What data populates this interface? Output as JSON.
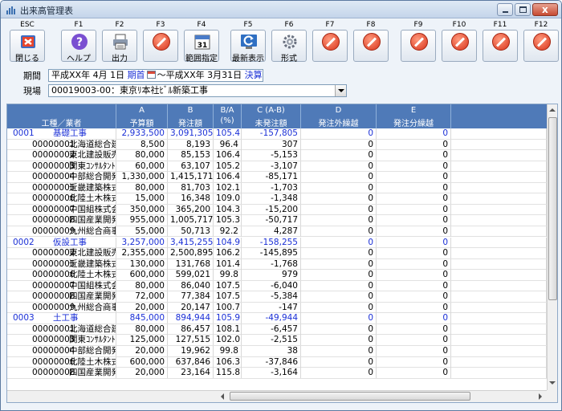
{
  "window": {
    "title": "出来高管理表",
    "close_glyph": "x",
    "colors": {
      "titlebar": "#c4d5ea",
      "header": "#4f7ab8",
      "group_text": "#1a2fd6",
      "close": "#c74b32"
    }
  },
  "toolbar": {
    "buttons": [
      {
        "key": "ESC",
        "label": "閉じる",
        "icon": "exit-icon"
      },
      {
        "key": "F1",
        "label": "ヘルプ",
        "icon": "help-icon"
      },
      {
        "key": "F2",
        "label": "出力",
        "icon": "printer-icon"
      },
      {
        "key": "F3",
        "label": "",
        "icon": "disabled-icon"
      },
      {
        "key": "F4",
        "label": "範囲指定",
        "icon": "calendar-icon"
      },
      {
        "key": "F5",
        "label": "最新表示",
        "icon": "refresh-icon"
      },
      {
        "key": "F6",
        "label": "形式",
        "icon": "gear-icon"
      },
      {
        "key": "F7",
        "label": "",
        "icon": "disabled-icon"
      },
      {
        "key": "F8",
        "label": "",
        "icon": "disabled-icon"
      },
      {
        "key": "F9",
        "label": "",
        "icon": "disabled-icon"
      },
      {
        "key": "F10",
        "label": "",
        "icon": "disabled-icon"
      },
      {
        "key": "F11",
        "label": "",
        "icon": "disabled-icon"
      },
      {
        "key": "F12",
        "label": "",
        "icon": "disabled-icon"
      }
    ]
  },
  "filters": {
    "period_label": "期間",
    "period_from": "平成XX年 4月 1日",
    "period_from_tag": "期首",
    "period_sep": "～",
    "period_to": "平成XX年 3月31日",
    "period_to_tag": "決算",
    "site_label": "現場",
    "site_value": "00019003-00：東京ﾘ本社ﾋﾞﾙ新築工事"
  },
  "grid": {
    "columns": [
      {
        "l1": "",
        "l2": "工種／業者"
      },
      {
        "l1": "A",
        "l2": "予算額"
      },
      {
        "l1": "B",
        "l2": "発注額"
      },
      {
        "l1": "B/A",
        "l2": "(%)"
      },
      {
        "l1": "C (A-B)",
        "l2": "未発注額"
      },
      {
        "l1": "D",
        "l2": "発注外繰越"
      },
      {
        "l1": "E",
        "l2": "発注分繰越"
      }
    ],
    "rows": [
      {
        "group": true,
        "code": "0001",
        "name": "基礎工事",
        "a": "2,933,500",
        "b": "3,091,305",
        "pct": "105.4",
        "c": "-157,805",
        "d": "0",
        "e": "0"
      },
      {
        "group": false,
        "code": "00000001",
        "name": "北海道総合建設株",
        "a": "8,500",
        "b": "8,193",
        "pct": "96.4",
        "c": "307",
        "d": "0",
        "e": "0"
      },
      {
        "group": false,
        "code": "00000002",
        "name": "東北建設販売株式",
        "a": "80,000",
        "b": "85,153",
        "pct": "106.4",
        "c": "-5,153",
        "d": "0",
        "e": "0"
      },
      {
        "group": false,
        "code": "00000003",
        "name": "関東ｺﾝｻﾙﾀﾝﾄ株式",
        "a": "60,000",
        "b": "63,107",
        "pct": "105.2",
        "c": "-3,107",
        "d": "0",
        "e": "0"
      },
      {
        "group": false,
        "code": "00000004",
        "name": "中部総合開発株式",
        "a": "1,330,000",
        "b": "1,415,171",
        "pct": "106.4",
        "c": "-85,171",
        "d": "0",
        "e": "0"
      },
      {
        "group": false,
        "code": "00000005",
        "name": "近畿建築株式会社",
        "a": "80,000",
        "b": "81,703",
        "pct": "102.1",
        "c": "-1,703",
        "d": "0",
        "e": "0"
      },
      {
        "group": false,
        "code": "00000006",
        "name": "北陸土木株式会社",
        "a": "15,000",
        "b": "16,348",
        "pct": "109.0",
        "c": "-1,348",
        "d": "0",
        "e": "0"
      },
      {
        "group": false,
        "code": "00000007",
        "name": "中国組株式会社",
        "a": "350,000",
        "b": "365,200",
        "pct": "104.3",
        "c": "-15,200",
        "d": "0",
        "e": "0"
      },
      {
        "group": false,
        "code": "00000008",
        "name": "四国産業開発株式",
        "a": "955,000",
        "b": "1,005,717",
        "pct": "105.3",
        "c": "-50,717",
        "d": "0",
        "e": "0"
      },
      {
        "group": false,
        "code": "00000009",
        "name": "九州総合商事株式",
        "a": "55,000",
        "b": "50,713",
        "pct": "92.2",
        "c": "4,287",
        "d": "0",
        "e": "0"
      },
      {
        "group": true,
        "code": "0002",
        "name": "仮設工事",
        "a": "3,257,000",
        "b": "3,415,255",
        "pct": "104.9",
        "c": "-158,255",
        "d": "0",
        "e": "0"
      },
      {
        "group": false,
        "code": "00000002",
        "name": "東北建設販売株式",
        "a": "2,355,000",
        "b": "2,500,895",
        "pct": "106.2",
        "c": "-145,895",
        "d": "0",
        "e": "0"
      },
      {
        "group": false,
        "code": "00000005",
        "name": "近畿建築株式会社",
        "a": "130,000",
        "b": "131,768",
        "pct": "101.4",
        "c": "-1,768",
        "d": "0",
        "e": "0"
      },
      {
        "group": false,
        "code": "00000006",
        "name": "北陸土木株式会社",
        "a": "600,000",
        "b": "599,021",
        "pct": "99.8",
        "c": "979",
        "d": "0",
        "e": "0"
      },
      {
        "group": false,
        "code": "00000007",
        "name": "中国組株式会社",
        "a": "80,000",
        "b": "86,040",
        "pct": "107.5",
        "c": "-6,040",
        "d": "0",
        "e": "0"
      },
      {
        "group": false,
        "code": "00000008",
        "name": "四国産業開発株式",
        "a": "72,000",
        "b": "77,384",
        "pct": "107.5",
        "c": "-5,384",
        "d": "0",
        "e": "0"
      },
      {
        "group": false,
        "code": "00000009",
        "name": "九州総合商事株式",
        "a": "20,000",
        "b": "20,147",
        "pct": "100.7",
        "c": "-147",
        "d": "0",
        "e": "0"
      },
      {
        "group": true,
        "code": "0003",
        "name": "土工事",
        "a": "845,000",
        "b": "894,944",
        "pct": "105.9",
        "c": "-49,944",
        "d": "0",
        "e": "0"
      },
      {
        "group": false,
        "code": "00000001",
        "name": "北海道総合建設株",
        "a": "80,000",
        "b": "86,457",
        "pct": "108.1",
        "c": "-6,457",
        "d": "0",
        "e": "0"
      },
      {
        "group": false,
        "code": "00000003",
        "name": "関東ｺﾝｻﾙﾀﾝﾄ株式",
        "a": "125,000",
        "b": "127,515",
        "pct": "102.0",
        "c": "-2,515",
        "d": "0",
        "e": "0"
      },
      {
        "group": false,
        "code": "00000004",
        "name": "中部総合開発株式",
        "a": "20,000",
        "b": "19,962",
        "pct": "99.8",
        "c": "38",
        "d": "0",
        "e": "0"
      },
      {
        "group": false,
        "code": "00000006",
        "name": "北陸土木株式会社",
        "a": "600,000",
        "b": "637,846",
        "pct": "106.3",
        "c": "-37,846",
        "d": "0",
        "e": "0"
      },
      {
        "group": false,
        "code": "00000008",
        "name": "四国産業開発株式",
        "a": "20,000",
        "b": "23,164",
        "pct": "115.8",
        "c": "-3,164",
        "d": "0",
        "e": "0"
      }
    ]
  }
}
